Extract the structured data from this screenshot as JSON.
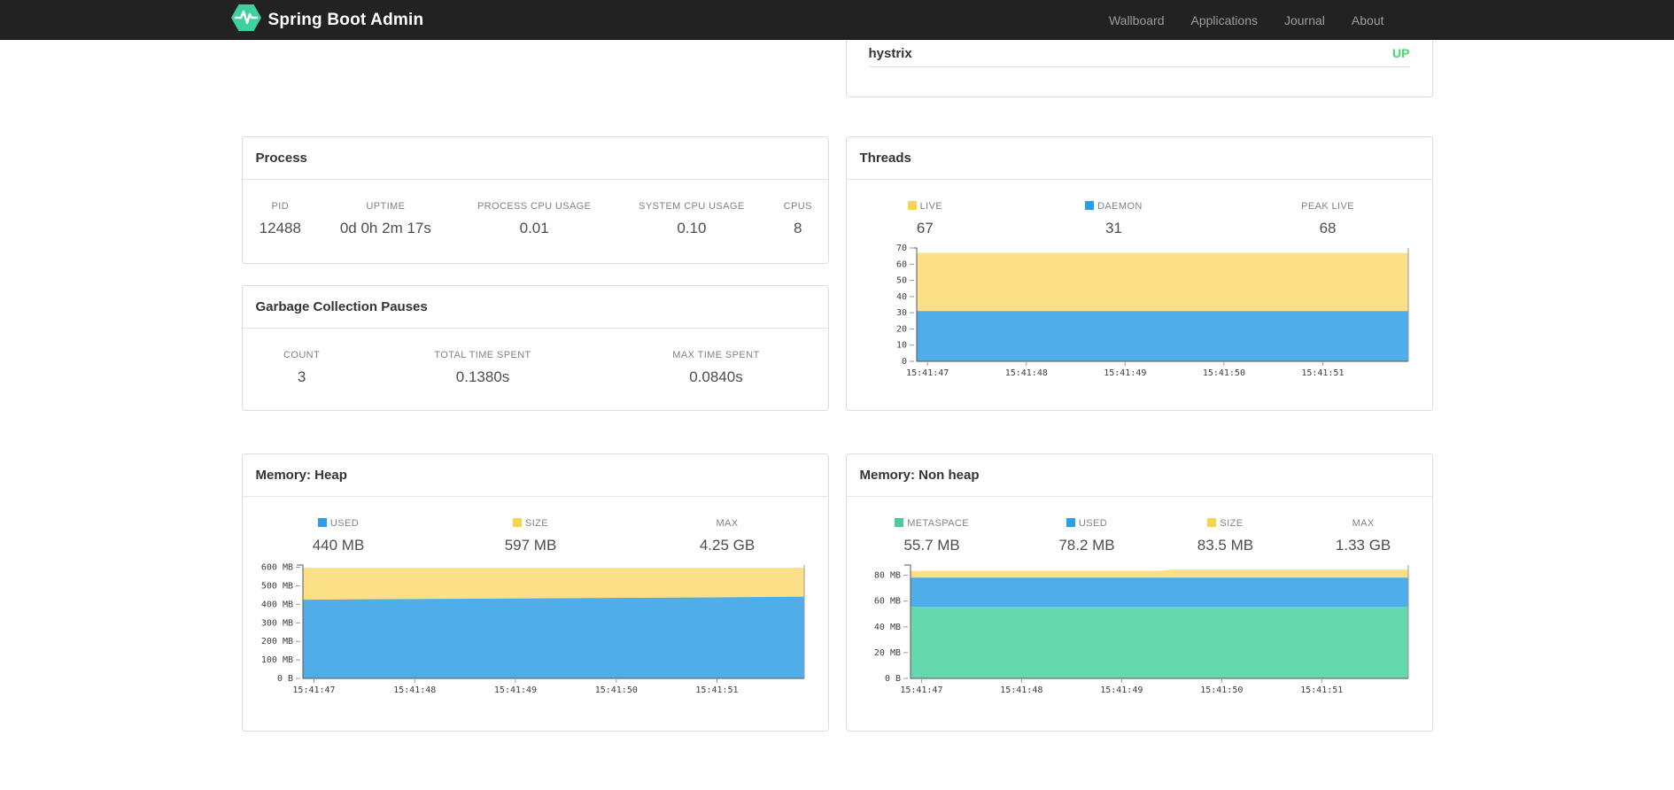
{
  "navbar": {
    "brand": "Spring Boot Admin",
    "items": [
      {
        "label": "Wallboard"
      },
      {
        "label": "Applications"
      },
      {
        "label": "Journal"
      },
      {
        "label": "About"
      }
    ]
  },
  "application_status": {
    "name": "hystrix",
    "status": "UP",
    "status_color": "#42d96b"
  },
  "panels": {
    "process": {
      "title": "Process",
      "metrics": [
        {
          "label": "PID",
          "value": "12488"
        },
        {
          "label": "UPTIME",
          "value": "0d 0h 2m 17s"
        },
        {
          "label": "PROCESS CPU USAGE",
          "value": "0.01"
        },
        {
          "label": "SYSTEM CPU USAGE",
          "value": "0.10"
        },
        {
          "label": "CPUS",
          "value": "8"
        }
      ]
    },
    "gc": {
      "title": "Garbage Collection Pauses",
      "metrics": [
        {
          "label": "COUNT",
          "value": "3"
        },
        {
          "label": "TOTAL TIME SPENT",
          "value": "0.1380s"
        },
        {
          "label": "MAX TIME SPENT",
          "value": "0.0840s"
        }
      ]
    },
    "threads": {
      "title": "Threads",
      "metrics": [
        {
          "label": "LIVE",
          "value": "67",
          "color": "#f8d54e"
        },
        {
          "label": "DAEMON",
          "value": "31",
          "color": "#2b9fe8"
        },
        {
          "label": "PEAK LIVE",
          "value": "68"
        }
      ]
    },
    "memory_heap": {
      "title": "Memory: Heap",
      "metrics": [
        {
          "label": "USED",
          "value": "440 MB",
          "color": "#2b9fe8"
        },
        {
          "label": "SIZE",
          "value": "597 MB",
          "color": "#f8d54e"
        },
        {
          "label": "MAX",
          "value": "4.25 GB"
        }
      ]
    },
    "memory_nonheap": {
      "title": "Memory: Non heap",
      "metrics": [
        {
          "label": "METASPACE",
          "value": "55.7 MB",
          "color": "#4fc998"
        },
        {
          "label": "USED",
          "value": "78.2 MB",
          "color": "#2b9fe8"
        },
        {
          "label": "SIZE",
          "value": "83.5 MB",
          "color": "#f8d54e"
        },
        {
          "label": "MAX",
          "value": "1.33 GB"
        }
      ]
    }
  },
  "chart_data": [
    {
      "title": "Threads",
      "type": "area",
      "stacked": true,
      "legend_position": "top",
      "grid": false,
      "y_max": 70,
      "y_ticks": [
        {
          "value": 0,
          "label": "0"
        },
        {
          "value": 10,
          "label": "10"
        },
        {
          "value": 20,
          "label": "20"
        },
        {
          "value": 30,
          "label": "30"
        },
        {
          "value": 40,
          "label": "40"
        },
        {
          "value": 50,
          "label": "50"
        },
        {
          "value": 60,
          "label": "60"
        },
        {
          "value": 70,
          "label": "70"
        }
      ],
      "x_ticks": [
        "15:41:47",
        "15:41:48",
        "15:41:49",
        "15:41:50",
        "15:41:51"
      ],
      "series": [
        {
          "name": "LIVE",
          "color": "#fce087",
          "points": [
            [
              0,
              67
            ],
            [
              1,
              67
            ]
          ]
        },
        {
          "name": "DAEMON",
          "color": "#4faeea",
          "points": [
            [
              0,
              31
            ],
            [
              1,
              31
            ]
          ]
        }
      ]
    },
    {
      "title": "Memory: Heap",
      "type": "area",
      "stacked": true,
      "legend_position": "top",
      "grid": false,
      "y_max": 612,
      "y_ticks": [
        {
          "value": 0,
          "label": "0 B"
        },
        {
          "value": 100,
          "label": "100 MB"
        },
        {
          "value": 200,
          "label": "200 MB"
        },
        {
          "value": 300,
          "label": "300 MB"
        },
        {
          "value": 400,
          "label": "400 MB"
        },
        {
          "value": 500,
          "label": "500 MB"
        },
        {
          "value": 600,
          "label": "600 MB"
        }
      ],
      "x_ticks": [
        "15:41:47",
        "15:41:48",
        "15:41:49",
        "15:41:50",
        "15:41:51"
      ],
      "series": [
        {
          "name": "SIZE",
          "color": "#fce087",
          "points": [
            [
              0,
              597
            ],
            [
              1,
              597
            ]
          ]
        },
        {
          "name": "USED",
          "color": "#4faeea",
          "points": [
            [
              0,
              425
            ],
            [
              0.3,
              430
            ],
            [
              0.55,
              433
            ],
            [
              0.8,
              437
            ],
            [
              1,
              441
            ]
          ]
        }
      ]
    },
    {
      "title": "Memory: Non heap",
      "type": "area",
      "stacked": true,
      "legend_position": "top",
      "grid": false,
      "y_max": 88,
      "y_ticks": [
        {
          "value": 0,
          "label": "0 B"
        },
        {
          "value": 20,
          "label": "20 MB"
        },
        {
          "value": 40,
          "label": "40 MB"
        },
        {
          "value": 60,
          "label": "60 MB"
        },
        {
          "value": 80,
          "label": "80 MB"
        }
      ],
      "x_ticks": [
        "15:41:47",
        "15:41:48",
        "15:41:49",
        "15:41:50",
        "15:41:51"
      ],
      "series": [
        {
          "name": "SIZE",
          "color": "#fce087",
          "points": [
            [
              0,
              83.5
            ],
            [
              0.5,
              83.5
            ],
            [
              0.53,
              84.6
            ],
            [
              1,
              84.6
            ]
          ]
        },
        {
          "name": "USED",
          "color": "#4faeea",
          "points": [
            [
              0,
              78.2
            ],
            [
              1,
              78.2
            ]
          ]
        },
        {
          "name": "METASPACE",
          "color": "#66d8ad",
          "points": [
            [
              0,
              55.7
            ],
            [
              1,
              55.7
            ]
          ]
        }
      ]
    }
  ]
}
